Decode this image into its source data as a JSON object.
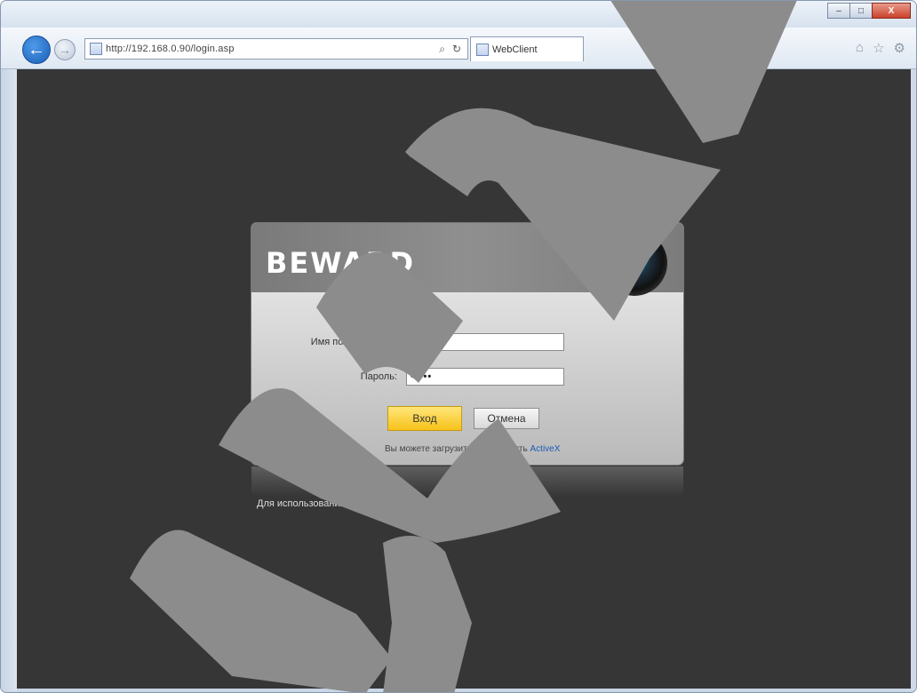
{
  "browser": {
    "url": "http://192.168.0.90/login.asp",
    "tab_title": "WebClient",
    "back_glyph": "←",
    "forward_glyph": "→",
    "search_glyph": "⌕",
    "refresh_glyph": "↻",
    "home_icon": "home-icon",
    "favorites_icon": "star-icon",
    "tools_icon": "gear-icon",
    "window_controls": {
      "minimize": "–",
      "maximize": "□",
      "close": "X"
    }
  },
  "login": {
    "logo": "BEWARD",
    "username_label": "Имя пользователя:",
    "username_value": "admin",
    "password_label": "Пароль:",
    "password_value": "•••••",
    "enter_button": "Вход",
    "cancel_button": "Отмена",
    "note_prefix": "Вы можете загрузить и установить",
    "note_link": "ActiveX"
  },
  "footer_note": "Для использования всех функций устройства ознакомьтесь с",
  "colors": {
    "background": "#363636",
    "accent_yellow": "#f7c21a",
    "link_blue": "#1d5bb8"
  }
}
